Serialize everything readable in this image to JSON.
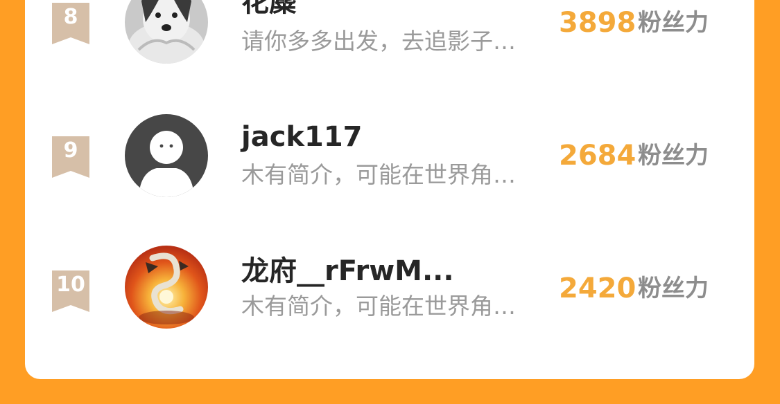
{
  "colors": {
    "background": "#FF9E24",
    "card": "#ffffff",
    "score": "#F4A93A",
    "badge": "#D6BFA8",
    "name": "#262626",
    "bio": "#9a9a9a"
  },
  "leaderboard": {
    "rows": [
      {
        "rank": "8",
        "name": "花麋",
        "bio": "请你多多出发，去追影子…",
        "score": "3898",
        "unit": "粉丝力",
        "avatar_icon": "dog-avatar"
      },
      {
        "rank": "9",
        "name": "jack117",
        "bio": "木有简介，可能在世界角…",
        "score": "2684",
        "unit": "粉丝力",
        "avatar_icon": "default-user-avatar"
      },
      {
        "rank": "10",
        "name": "龙府__rFrwM...",
        "bio": "木有简介，可能在世界角…",
        "score": "2420",
        "unit": "粉丝力",
        "avatar_icon": "dragon-avatar"
      }
    ]
  }
}
